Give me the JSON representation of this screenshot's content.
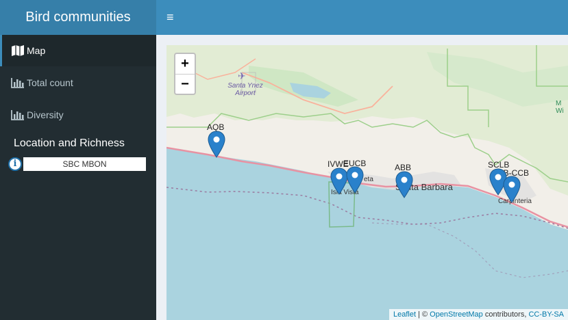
{
  "app": {
    "title": "Bird communities"
  },
  "sidebar": {
    "items": [
      {
        "label": "Map",
        "icon": "map-icon",
        "active": true
      },
      {
        "label": "Total count",
        "icon": "bar-chart-icon",
        "active": false
      },
      {
        "label": "Diversity",
        "icon": "bar-chart-icon",
        "active": false
      }
    ],
    "section_title": "Location and Richness",
    "info_value": "SBC MBON"
  },
  "map": {
    "zoom_in": "+",
    "zoom_out": "−",
    "markers": [
      {
        "label": "AQB"
      },
      {
        "label": "IVWE"
      },
      {
        "label": "EUCB"
      },
      {
        "label": "ABB"
      },
      {
        "label": "SCLB"
      },
      {
        "label": "CSB-CCB"
      }
    ],
    "places": {
      "airport": "Santa Ynez Airport",
      "santa_barbara": "Santa Barbara",
      "isla_vista": "Isla Vista",
      "goleta": "eta",
      "carpinteria": "Carpinteria",
      "wi": "M Wi"
    },
    "attribution": {
      "leaflet": "Leaflet",
      "sep": " | © ",
      "osm": "OpenStreetMap",
      "contrib": " contributors, ",
      "license": "CC-BY-SA"
    }
  },
  "colors": {
    "header": "#3c8dbc",
    "logo": "#367fa9",
    "sidebar": "#222d32",
    "water": "#aad3df",
    "land": "#f2efe9",
    "marker": "#2a81cb"
  }
}
